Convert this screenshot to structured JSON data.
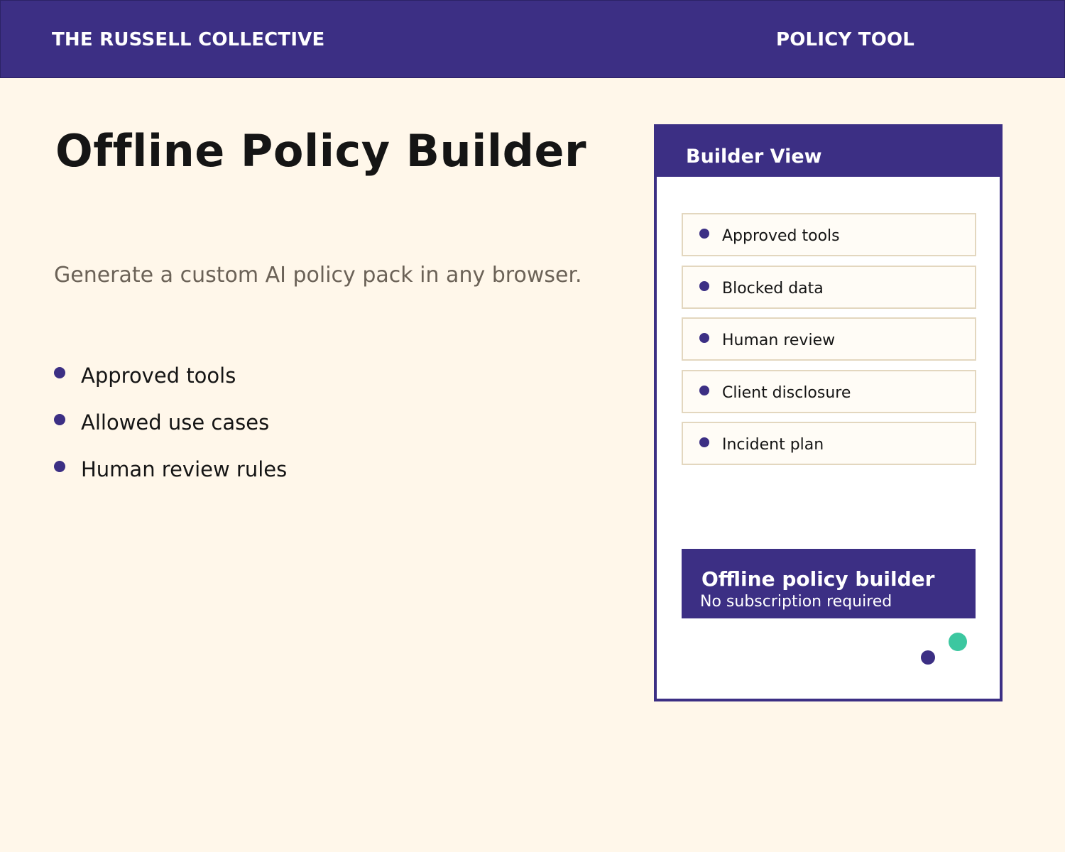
{
  "header": {
    "brand": "THE RUSSELL COLLECTIVE",
    "tool": "POLICY TOOL"
  },
  "main": {
    "title": "Offline Policy Builder",
    "subtitle": "Generate a custom AI policy pack in any browser.",
    "features": [
      "Approved tools",
      "Allowed use cases",
      "Human review rules"
    ]
  },
  "panel": {
    "title": "Builder View",
    "items": [
      "Approved tools",
      "Blocked data",
      "Human review",
      "Client disclosure",
      "Incident plan"
    ],
    "callout_title": "Offline policy builder",
    "callout_subtitle": "No subscription required"
  },
  "colors": {
    "primary": "#3c2f84",
    "background": "#fff7ea",
    "accent": "#3cc7a0"
  }
}
